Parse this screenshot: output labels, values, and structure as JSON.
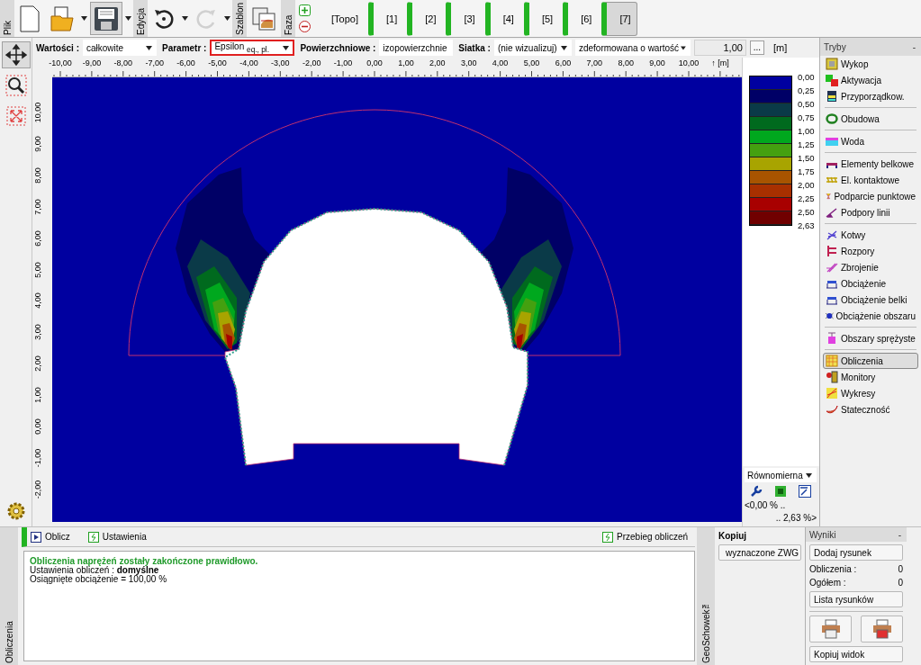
{
  "toolbar": {
    "file_tab": "Plik",
    "edit_tab": "Edycja",
    "template_tab": "Szablon",
    "phase_tab": "Faza",
    "redo_disabled": true,
    "phases": [
      {
        "label": "[Topo]",
        "kind": "topo",
        "selected": false
      },
      {
        "label": "[1]",
        "kind": "stage",
        "selected": false
      },
      {
        "label": "[2]",
        "kind": "stage",
        "selected": false
      },
      {
        "label": "[3]",
        "kind": "stage",
        "selected": false
      },
      {
        "label": "[4]",
        "kind": "stage",
        "selected": false
      },
      {
        "label": "[5]",
        "kind": "stage",
        "selected": false
      },
      {
        "label": "[6]",
        "kind": "stage",
        "selected": false
      },
      {
        "label": "[7]",
        "kind": "stage",
        "selected": true
      }
    ]
  },
  "tools": [
    {
      "kind": "move",
      "selected": true
    },
    {
      "kind": "zoom",
      "selected": false
    },
    {
      "kind": "fit",
      "selected": false
    }
  ],
  "options": {
    "fields": [
      {
        "label": "Wartości :",
        "value": "całkowite",
        "highlighted": false
      },
      {
        "label": "Parametr :",
        "value": "Epsilon $_{eq., pl.}$",
        "highlighted": true
      },
      {
        "label": "Powierzchniowe :",
        "value": "izopowierzchnie",
        "highlighted": false
      },
      {
        "label": "Siatka :",
        "value": "(nie wizualizuj)",
        "highlighted": false
      },
      {
        "value": "zdeformowana o wartość",
        "highlighted": false
      }
    ],
    "scale_value": "1,00",
    "more_button": "...",
    "unit": "[m]"
  },
  "ruler": {
    "x_ticks": [
      "-10,00",
      "-9,00",
      "-8,00",
      "-7,00",
      "-6,00",
      "-5,00",
      "-4,00",
      "-3,00",
      "-2,00",
      "-1,00",
      "0,00",
      "1,00",
      "2,00",
      "3,00",
      "4,00",
      "5,00",
      "6,00",
      "7,00",
      "8,00",
      "9,00",
      "10,00"
    ],
    "x_unit": "↑ [m]",
    "y_ticks": [
      "10,00",
      "9,00",
      "8,00",
      "7,00",
      "6,00",
      "5,00",
      "4,00",
      "3,00",
      "2,00",
      "1,00",
      "0,00",
      "-1,00",
      "-2,00"
    ]
  },
  "legend": {
    "bands": [
      {
        "color": "#0000a0"
      },
      {
        "color": "#000066"
      },
      {
        "color": "#0a3a48"
      },
      {
        "color": "#006a1e"
      },
      {
        "color": "#00a81e"
      },
      {
        "color": "#44a010"
      },
      {
        "color": "#a8a400"
      },
      {
        "color": "#a85400"
      },
      {
        "color": "#a83000"
      },
      {
        "color": "#a80000"
      },
      {
        "color": "#700000"
      }
    ],
    "labels": [
      "0,00",
      "0,25",
      "0,50",
      "0,75",
      "1,00",
      "1,25",
      "1,50",
      "1,75",
      "2,00",
      "2,25",
      "2,50",
      "2,63"
    ],
    "scale_mode": "Równomierna",
    "range_min": "<0,00 % ..",
    "range_max": ".. 2,63 %>"
  },
  "modes": {
    "title": "Tryby",
    "collapse": "-",
    "groups": [
      [
        {
          "label": "Wykop",
          "kind": "frame",
          "selected": false
        },
        {
          "label": "Aktywacja",
          "kind": "squares",
          "selected": false
        },
        {
          "label": "Przyporządkow.",
          "kind": "layers",
          "selected": false
        }
      ],
      [
        {
          "label": "Obudowa",
          "kind": "ring",
          "selected": false
        }
      ],
      [
        {
          "label": "Woda",
          "kind": "water",
          "selected": false
        }
      ],
      [
        {
          "label": "Elementy belkowe",
          "kind": "beam",
          "selected": false
        },
        {
          "label": "El. kontaktowe",
          "kind": "hatch",
          "selected": false
        },
        {
          "label": "Podparcie punktowe",
          "kind": "support",
          "selected": false
        },
        {
          "label": "Podpory linii",
          "kind": "line-support",
          "selected": false
        }
      ],
      [
        {
          "label": "Kotwy",
          "kind": "anchor",
          "selected": false
        },
        {
          "label": "Rozpory",
          "kind": "strut",
          "selected": false
        },
        {
          "label": "Zbrojenie",
          "kind": "rebar",
          "selected": false
        },
        {
          "label": "Obciążenie",
          "kind": "load",
          "selected": false
        },
        {
          "label": "Obciążenie belki",
          "kind": "load",
          "selected": false
        },
        {
          "label": "Obciążenie obszaru",
          "kind": "area-load",
          "selected": false
        }
      ],
      [
        {
          "label": "Obszary sprężyste",
          "kind": "spring",
          "selected": false
        }
      ],
      [
        {
          "label": "Obliczenia",
          "kind": "grid",
          "selected": true
        },
        {
          "label": "Monitory",
          "kind": "monitor",
          "selected": false
        },
        {
          "label": "Wykresy",
          "kind": "chart",
          "selected": false
        },
        {
          "label": "Stateczność",
          "kind": "slip",
          "selected": false
        }
      ]
    ]
  },
  "calc_panel": {
    "tab": "Obliczenia",
    "buttons": [
      {
        "label": "Oblicz",
        "kind": "run"
      },
      {
        "label": "Ustawienia",
        "kind": "settings"
      }
    ],
    "right_button": "Przebieg obliczeń",
    "messages": [
      {
        "text": "Obliczenia naprężeń zostały zakończone prawidłowo.",
        "kind": "success"
      },
      {
        "text": "Ustawienia obliczeń : **domyślne**",
        "kind": "info"
      },
      {
        "text": "Osiągnięte obciążenie = 100,00 %",
        "kind": "info"
      }
    ]
  },
  "clipboard": {
    "tab": "GeoSchowek™",
    "title": "Kopiuj",
    "button": "wyznaczone ZWG"
  },
  "results": {
    "title": "Wyniki",
    "collapse": "-",
    "add_button": "Dodaj rysunek",
    "counts": [
      {
        "label": "Obliczenia :",
        "value": "0"
      },
      {
        "label": "Ogółem :",
        "value": "0"
      }
    ],
    "list_button": "Lista rysunków",
    "copy_button": "Kopiuj widok"
  }
}
